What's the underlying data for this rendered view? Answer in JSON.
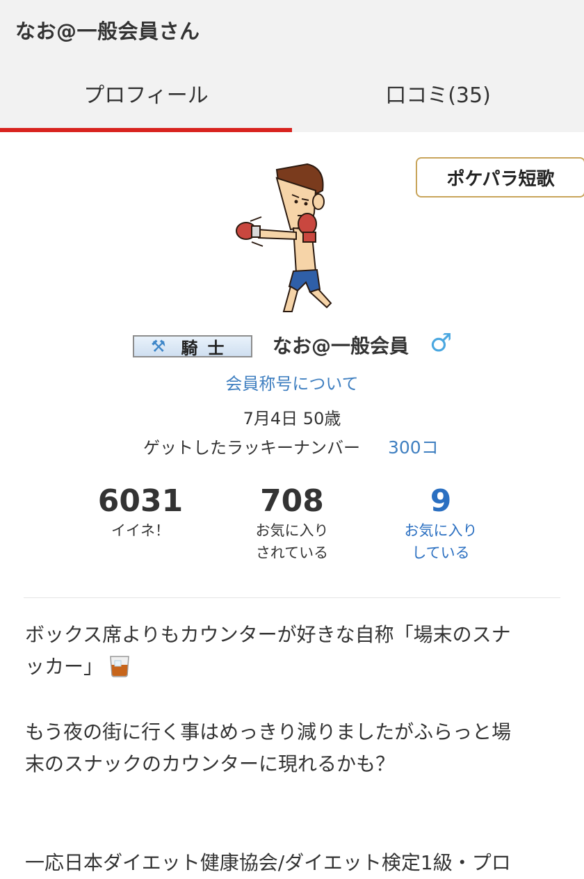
{
  "header": {
    "title": "なお@一般会員さん"
  },
  "tabs": [
    {
      "label": "プロフィール",
      "active": true
    },
    {
      "label": "口コミ(35)",
      "active": false
    }
  ],
  "profile": {
    "tanka_button": "ポケパラ短歌",
    "avatar_icon": "boxer-avatar-icon",
    "rank_icon": "crossed-axes-icon",
    "rank_label": "騎士",
    "user_name": "なお@一般会員",
    "gender_symbol": "♂",
    "title_link": "会員称号について",
    "birthday": "7月4日 50歳",
    "lucky_label": "ゲットしたラッキーナンバー",
    "lucky_value": "300コ"
  },
  "stats": [
    {
      "value": "6031",
      "label": "イイネ！"
    },
    {
      "value": "708",
      "label": "お気に入り\nされている"
    },
    {
      "value": "9",
      "label": "お気に入り\nしている"
    }
  ],
  "bio": {
    "p1_line1": "ボックス席よりもカウンターが好きな自称「場末のスナ",
    "p1_line2": "ッカー」",
    "p1_icon": "whiskey-glass-icon",
    "p2_line1": "もう夜の街に行く事はめっきり減りましたがふらっと場",
    "p2_line2": "末のスナックのカウンターに現れるかも？",
    "p3_line1": "一応日本ダイエット健康協会/ダイエット検定1級・プロ"
  },
  "colors": {
    "accent_red": "#d8231f",
    "link_blue": "#3f7fc0",
    "gold_border": "#c8a45a",
    "header_bg": "#f2f2f2"
  }
}
